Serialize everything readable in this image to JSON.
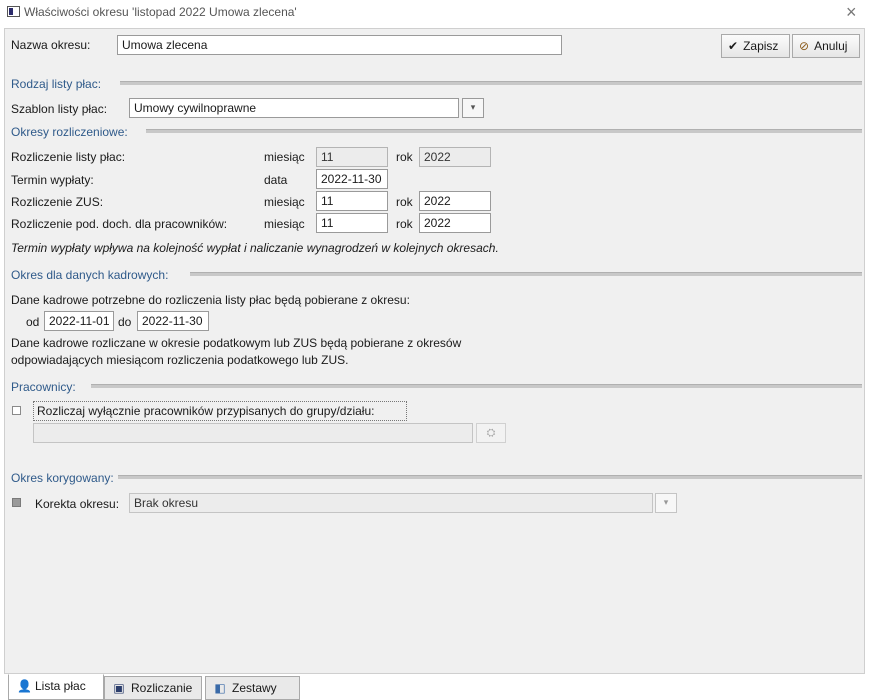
{
  "window": {
    "title": "Właściwości okresu 'listopad 2022 Umowa zlecena'",
    "close_icon": "×"
  },
  "header": {
    "name_label": "Nazwa okresu:",
    "name_value": "Umowa zlecena",
    "save_label": "Zapisz",
    "save_icon": "✔",
    "cancel_label": "Anuluj",
    "cancel_icon": "⊘"
  },
  "payroll_type": {
    "section_title": "Rodzaj listy płac:",
    "template_label": "Szablon listy płac:",
    "template_value": "Umowy cywilnoprawne",
    "dropdown_glyph": "▾"
  },
  "settlement": {
    "section_title": "Okresy rozliczeniowe:",
    "rows": [
      {
        "label": "Rozliczenie listy płac:",
        "unit": "miesiąc",
        "value": "11",
        "year_label": "rok",
        "year": "2022"
      },
      {
        "label": "Termin wypłaty:",
        "unit": "data",
        "value": "2022-11-30"
      },
      {
        "label": "Rozliczenie ZUS:",
        "unit": "miesiąc",
        "value": "11",
        "year_label": "rok",
        "year": "2022"
      },
      {
        "label": "Rozliczenie pod. doch. dla pracowników:",
        "unit": "miesiąc",
        "value": "11",
        "year_label": "rok",
        "year": "2022"
      }
    ],
    "note": "Termin wypłaty wpływa na kolejność wypłat i naliczanie wynagrodzeń w kolejnych okresach."
  },
  "hr_period": {
    "section_title": "Okres dla danych kadrowych:",
    "intro": "Dane kadrowe potrzebne do rozliczenia listy płac będą pobierane z okresu:",
    "from_label": "od",
    "from_value": "2022-11-01",
    "to_label": "do",
    "to_value": "2022-11-30",
    "note_line1": "Dane kadrowe rozliczane w okresie podatkowym lub ZUS będą pobierane z okresów",
    "note_line2": "odpowiadających miesiącom rozliczenia podatkowego lub ZUS."
  },
  "employees": {
    "section_title": "Pracownicy:",
    "checkbox_label": "Rozliczaj wyłącznie pracowników przypisanych do grupy/działu:",
    "group_value": "",
    "picker_icon": "⛭"
  },
  "corrected": {
    "section_title": "Okres korygowany:",
    "label": "Korekta okresu:",
    "value": "Brak okresu",
    "dropdown_glyph": "▾"
  },
  "tabs": [
    {
      "label": "Lista płac",
      "icon": "👤"
    },
    {
      "label": "Rozliczanie",
      "icon": "▣"
    },
    {
      "label": "Zestawy",
      "icon": "◧"
    }
  ],
  "colors": {
    "section_title": "#2f5a8a",
    "panel_bg": "#f0f0f0"
  }
}
